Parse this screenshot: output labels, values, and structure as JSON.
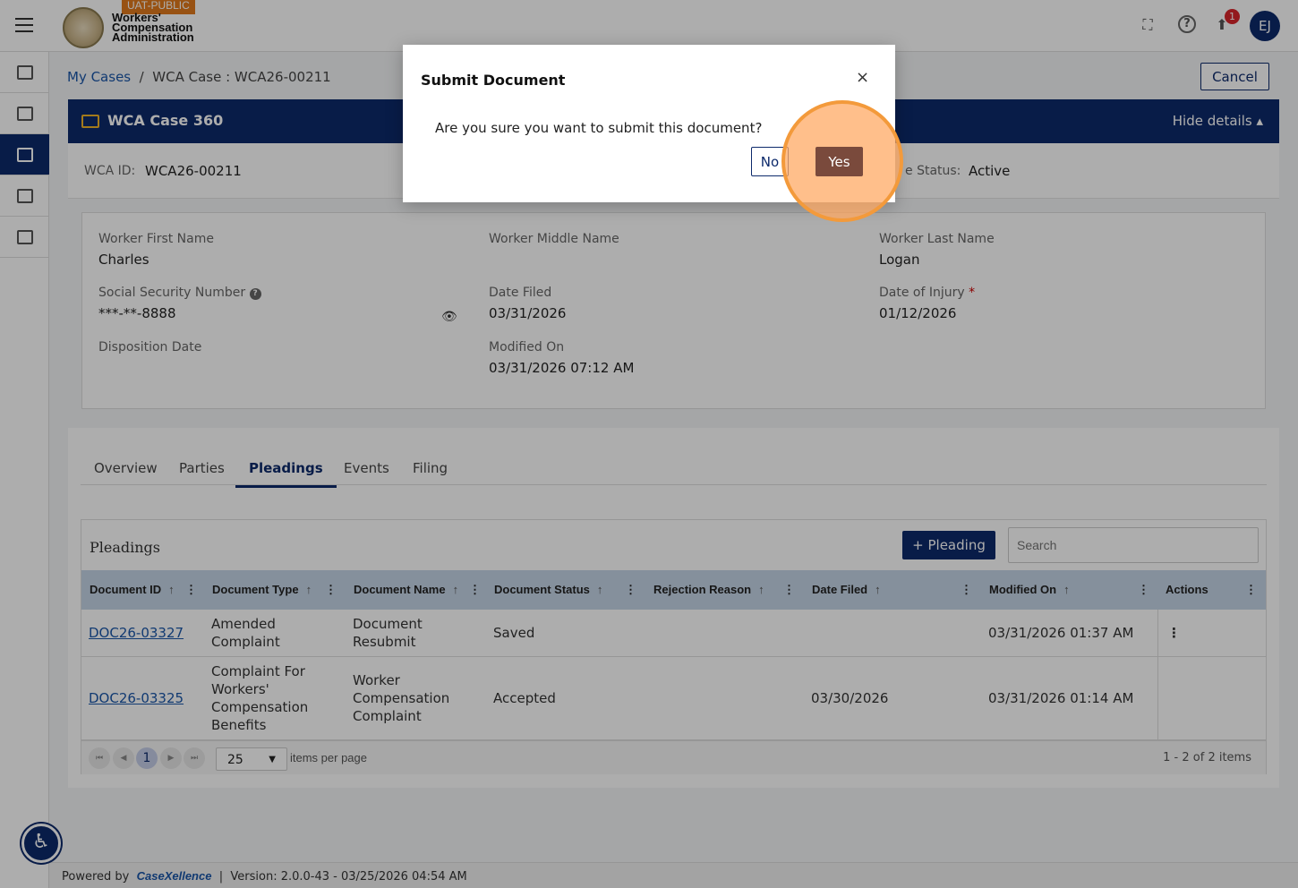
{
  "topbar": {
    "env_badge": "UAT-PUBLIC",
    "logo_line1": "Workers'",
    "logo_line2": "Compensation",
    "logo_line3": "Administration",
    "notification_count": "1",
    "avatar_initials": "EJ",
    "fullscreen_icon": "fullscreen-icon",
    "help_icon": "help-icon",
    "upload_icon": "upload-icon"
  },
  "breadcrumb": {
    "root": "My Cases",
    "separator": "/",
    "current": "WCA Case : WCA26-00211"
  },
  "cancel_label": "Cancel",
  "case_header": {
    "title": "WCA Case 360",
    "hide_details": "Hide details ▴"
  },
  "case_ids": {
    "wca_id_label": "WCA ID:",
    "wca_id_value": "WCA26-00211",
    "status_label": "e Status:",
    "status_value": "Active"
  },
  "details": {
    "first_name_label": "Worker First Name",
    "first_name": "Charles",
    "middle_name_label": "Worker Middle Name",
    "middle_name": "",
    "last_name_label": "Worker Last Name",
    "last_name": "Logan",
    "ssn_label": "Social Security Number",
    "ssn": "***-**-8888",
    "date_filed_label": "Date Filed",
    "date_filed": "03/31/2026",
    "date_injury_label": "Date of Injury",
    "date_injury": "01/12/2026",
    "disposition_label": "Disposition Date",
    "disposition": "",
    "modified_label": "Modified On",
    "modified": "03/31/2026 07:12 AM"
  },
  "tabs": [
    "Overview",
    "Parties",
    "Pleadings",
    "Events",
    "Filing"
  ],
  "pleadings": {
    "title": "Pleadings",
    "add_button": "+ Pleading",
    "search_placeholder": "Search",
    "columns": [
      "Document ID",
      "Document Type",
      "Document Name",
      "Document Status",
      "Rejection Reason",
      "Date Filed",
      "Modified On",
      "Actions"
    ],
    "rows": [
      {
        "doc_id": "DOC26-03327",
        "type_l1": "Amended",
        "type_l2": "Complaint",
        "type_l3": "",
        "type_l4": "",
        "name_l1": "Document",
        "name_l2": "Resubmit",
        "name_l3": "",
        "status": "Saved",
        "rejection": "",
        "date_filed": "",
        "modified": "03/31/2026 01:37 AM"
      },
      {
        "doc_id": "DOC26-03325",
        "type_l1": "Complaint For",
        "type_l2": "Workers'",
        "type_l3": "Compensation",
        "type_l4": "Benefits",
        "name_l1": "Worker",
        "name_l2": "Compensation",
        "name_l3": "Complaint",
        "status": "Accepted",
        "rejection": "",
        "date_filed": "03/30/2026",
        "modified": "03/31/2026 01:14 AM"
      }
    ],
    "current_page": "1",
    "per_page": "25",
    "per_page_label": "items per page",
    "range": "1 - 2 of 2 items"
  },
  "footer": {
    "powered_by": "Powered by",
    "brand": "CaseXellence",
    "separator": "|",
    "version": "Version: 2.0.0-43 - 03/25/2026 04:54 AM"
  },
  "dialog": {
    "title": "Submit Document",
    "close": "×",
    "message": "Are you sure you want to submit this document?",
    "no_label": "No",
    "yes_label": "Yes"
  },
  "colors": {
    "primary": "#0d2a6b",
    "accent": "#e07a1c",
    "highlight": "#f39a3b",
    "yes_button": "#7a4a3c"
  }
}
